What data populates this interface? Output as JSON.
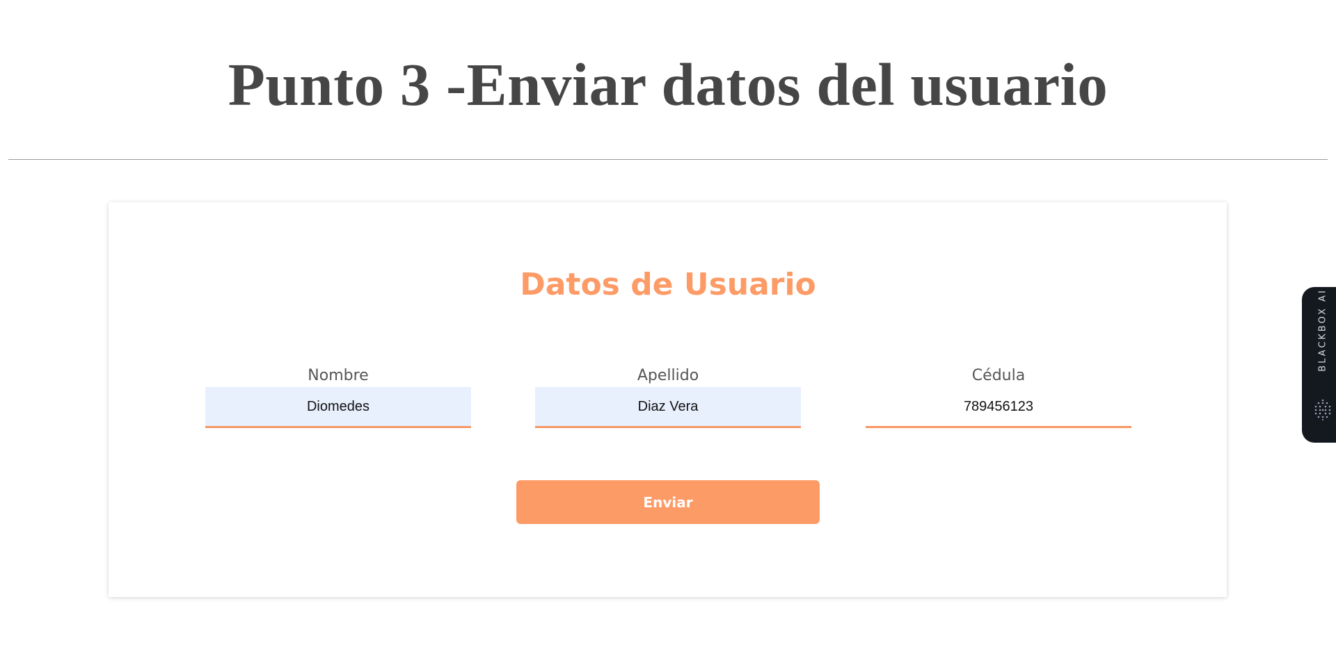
{
  "page": {
    "title": "Punto 3 -Enviar datos del usuario"
  },
  "form": {
    "title": "Datos de Usuario",
    "fields": [
      {
        "label": "Nombre",
        "value": "Diomedes"
      },
      {
        "label": "Apellido",
        "value": "Diaz Vera"
      },
      {
        "label": "Cédula",
        "value": "789456123"
      }
    ],
    "submit_label": "Enviar"
  },
  "extension_tab": {
    "label": "BLACKBOX AI",
    "icon": "blackbox-logo-icon"
  },
  "colors": {
    "accent": "#fd9b67",
    "title_text": "#464646",
    "autofill_background": "#e8f0fe",
    "extension_tab_background": "#14181f"
  }
}
